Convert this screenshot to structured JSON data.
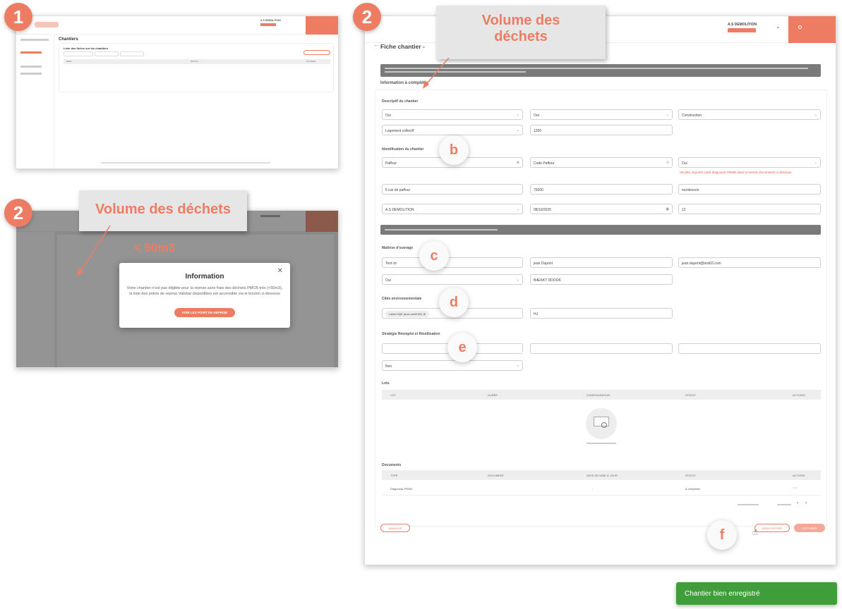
{
  "steps": {
    "one": "1",
    "two_a": "2",
    "two_b": "2"
  },
  "markers": {
    "b": "b",
    "c": "c",
    "d": "d",
    "e": "e",
    "f": "f"
  },
  "callouts": {
    "top": "Volume des déchets",
    "modal": "Volume des déchets",
    "modal_sub": "< 50m3"
  },
  "shot1": {
    "company": "A.S DEMOLITION",
    "page_title": "Chantiers",
    "list_title": "Liste des fiches sur les chantiers",
    "col_name": "NOM",
    "col_status": "STATUT",
    "col_actions": "ACTIONS"
  },
  "shot2": {
    "modal_title": "Information",
    "modal_text": "Votre chantier n'est pas éligible pour la reprise sans frais des déchets PMCB très (<50m3), la liste des points de reprise Valobat disponibles est accessible via le bouton ci-dessous",
    "modal_button": "VOIR LES POINT DE REPRISE"
  },
  "main": {
    "company": "A.S DEMOLITION",
    "title": "Fiche chantier -",
    "info_heading": "Information à compléter",
    "descriptif_heading": "Descriptif du chantier",
    "d_field1": "Oui",
    "d_field2": "Oui",
    "d_field3": "Construction",
    "d_field4": "Logement collectif",
    "d_field5": "1200",
    "ident_heading": "Identification du chantier",
    "i_field1": "Paffour",
    "i_field2": "Code Paffour",
    "i_field3": "Oui",
    "warning": "Veuillez importer votre diagnostic PEMD dans la section Documents ci-dessous",
    "i_field4": "6 rue de paffour",
    "i_field5": "75000",
    "i_field6": "montesson",
    "i_field7": "A.S DEMOLITION",
    "i_field8": "08/10/2025",
    "i_field9": "12",
    "mo_heading": "Maîtrise d'ouvrage",
    "mo_field1": "Test ctr",
    "mo_field2": "jean Dupont",
    "mo_field3": "jean.dupont@test03.com",
    "mo_field4": "Oui",
    "mo_field5": "B4EKKT DDOOK",
    "cible_heading": "Cible environnementale",
    "cible_chip": "Label HQE (hors certif NF)",
    "cible_value": "HJ",
    "strat_heading": "Stratégie Réemploi et Réutilisation",
    "strat_field4": "Non",
    "lots_heading": "Lots",
    "lots_cols": [
      "LOT",
      "DURÉE",
      "CONFIGURATION",
      "STATUT",
      "ACTIONS"
    ],
    "docs_heading": "Documents",
    "docs_cols": [
      "TYPE",
      "DOCUMENT",
      "DATE DE MISE À JOUR",
      "STATUT",
      "ACTIONS"
    ],
    "doc_row": [
      "Diagnostic PEMD",
      "",
      "-",
      "À compléter"
    ],
    "cancel": "ANNULER",
    "save": "ENREGISTRER",
    "cloturer": "CLÔTURER"
  },
  "toast": "Chantier bien enregistré",
  "colors": {
    "accent": "#ee7c62",
    "success": "#3f9e3a",
    "overlay": "#7a7a7a"
  }
}
